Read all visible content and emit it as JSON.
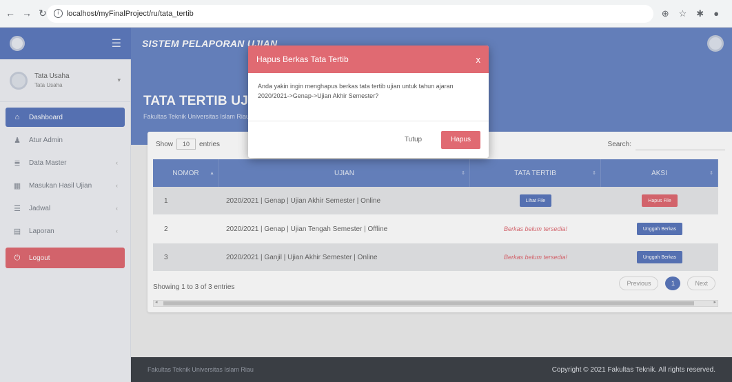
{
  "browser": {
    "url": "localhost/myFinalProject/ru/tata_tertib"
  },
  "header": {
    "title": "SISTEM PELAPORAN UJIAN"
  },
  "sidebar": {
    "user_name": "Tata Usaha",
    "user_role": "Tata Usaha",
    "items": [
      {
        "label": "Dashboard",
        "icon": "home-icon"
      },
      {
        "label": "Atur Admin",
        "icon": "user-icon"
      },
      {
        "label": "Data Master",
        "icon": "database-icon"
      },
      {
        "label": "Masukan Hasil Ujian",
        "icon": "table-icon"
      },
      {
        "label": "Jadwal",
        "icon": "list-icon"
      },
      {
        "label": "Laporan",
        "icon": "file-icon"
      },
      {
        "label": "Logout",
        "icon": "power-icon"
      }
    ]
  },
  "page": {
    "title": "TATA TERTIB UJIAN",
    "subtitle": "Fakultas Teknik Universitas Islam Riau"
  },
  "table_controls": {
    "show_label": "Show",
    "show_value": "10",
    "entries_label": "entries",
    "search_label": "Search:"
  },
  "table": {
    "columns": [
      "NOMOR",
      "UJIAN",
      "TATA TERTIB",
      "AKSI"
    ],
    "rows": [
      {
        "no": "1",
        "ujian": "2020/2021 | Genap | Ujian Akhir Semester | Online",
        "tata_tertib": "Lihat File",
        "aksi": "Hapus File"
      },
      {
        "no": "2",
        "ujian": "2020/2021 | Genap | Ujian Tengah Semester | Offline",
        "tata_tertib": "Berkas belum tersedia!",
        "aksi": "Unggah Berkas"
      },
      {
        "no": "3",
        "ujian": "2020/2021 | Ganjil | Ujian Akhir Semester | Online",
        "tata_tertib": "Berkas belum tersedia!",
        "aksi": "Unggah Berkas"
      }
    ]
  },
  "table_footer": {
    "info": "Showing 1 to 3 of 3 entries",
    "prev": "Previous",
    "page": "1",
    "next": "Next"
  },
  "footer": {
    "left": "Fakultas Teknik Universitas Islam Riau",
    "right": "Copyright © 2021 Fakultas Teknik. All rights reserved."
  },
  "modal": {
    "title": "Hapus Berkas Tata Tertib",
    "close": "x",
    "body": "Anda yakin ingin menghapus berkas tata tertib ujian untuk tahun ajaran 2020/2021->Genap->Ujian Akhir Semester?",
    "cancel": "Tutup",
    "confirm": "Hapus"
  },
  "colors": {
    "primary": "#6a86c5",
    "danger": "#e06a72",
    "footer": "#3e4249"
  }
}
